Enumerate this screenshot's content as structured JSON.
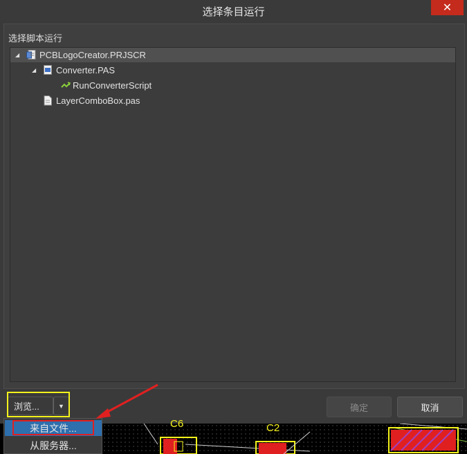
{
  "window": {
    "title": "选择条目运行",
    "close_icon": "close-icon"
  },
  "group_label": "选择脚本运行",
  "tree": [
    {
      "label": "PCBLogoCreator.PRJSCR",
      "icon": "project-file-icon",
      "expanded": true,
      "selected": true
    },
    {
      "label": "Converter.PAS",
      "icon": "pascal-file-icon",
      "expanded": true
    },
    {
      "label": "RunConverterScript",
      "icon": "procedure-icon"
    },
    {
      "label": "LayerComboBox.pas",
      "icon": "document-icon"
    }
  ],
  "buttons": {
    "browse": "浏览...",
    "ok": "确定",
    "cancel": "取消"
  },
  "browse_menu": [
    "来自文件...",
    "从服务器..."
  ],
  "pcb_labels": {
    "c6": "C6",
    "c2": "C2"
  },
  "colors": {
    "highlight_yellow": "#f4f21b",
    "highlight_red": "#e02020",
    "close_red": "#c42b1c",
    "menu_hover": "#2e6fae"
  }
}
